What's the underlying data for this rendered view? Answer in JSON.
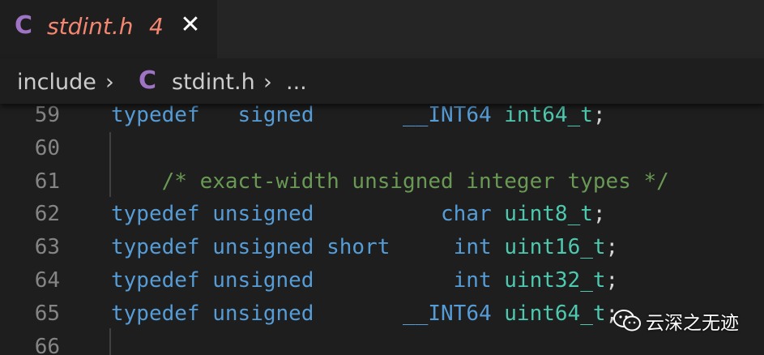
{
  "tab": {
    "icon": "C",
    "title": "stdint.h",
    "problem_count": "4",
    "close_glyph": "✕"
  },
  "breadcrumb": {
    "folder": "include",
    "separator": "›",
    "file_icon": "C",
    "file": "stdint.h",
    "more": "..."
  },
  "lines": [
    {
      "num": "59",
      "tokens": [
        [
          "kw",
          "typedef"
        ],
        [
          "pn",
          "   "
        ],
        [
          "kw",
          "signed"
        ],
        [
          "pn",
          "       "
        ],
        [
          "mc",
          "__INT64"
        ],
        [
          "pn",
          " "
        ],
        [
          "ty",
          "int64_t"
        ],
        [
          "pn",
          ";"
        ]
      ]
    },
    {
      "num": "60",
      "tokens": []
    },
    {
      "num": "61",
      "tokens": [
        [
          "pn",
          "    "
        ],
        [
          "cm",
          "/* exact-width unsigned integer types */"
        ]
      ]
    },
    {
      "num": "62",
      "tokens": [
        [
          "kw",
          "typedef"
        ],
        [
          "pn",
          " "
        ],
        [
          "kw",
          "unsigned"
        ],
        [
          "pn",
          "          "
        ],
        [
          "kw",
          "char"
        ],
        [
          "pn",
          " "
        ],
        [
          "ty",
          "uint8_t"
        ],
        [
          "pn",
          ";"
        ]
      ]
    },
    {
      "num": "63",
      "tokens": [
        [
          "kw",
          "typedef"
        ],
        [
          "pn",
          " "
        ],
        [
          "kw",
          "unsigned"
        ],
        [
          "pn",
          " "
        ],
        [
          "kw",
          "short"
        ],
        [
          "pn",
          "     "
        ],
        [
          "kw",
          "int"
        ],
        [
          "pn",
          " "
        ],
        [
          "ty",
          "uint16_t"
        ],
        [
          "pn",
          ";"
        ]
      ]
    },
    {
      "num": "64",
      "tokens": [
        [
          "kw",
          "typedef"
        ],
        [
          "pn",
          " "
        ],
        [
          "kw",
          "unsigned"
        ],
        [
          "pn",
          "           "
        ],
        [
          "kw",
          "int"
        ],
        [
          "pn",
          " "
        ],
        [
          "ty",
          "uint32_t"
        ],
        [
          "pn",
          ";"
        ]
      ]
    },
    {
      "num": "65",
      "tokens": [
        [
          "kw",
          "typedef"
        ],
        [
          "pn",
          " "
        ],
        [
          "kw",
          "unsigned"
        ],
        [
          "pn",
          "       "
        ],
        [
          "mc",
          "__INT64"
        ],
        [
          "pn",
          " "
        ],
        [
          "ty",
          "uint64_t"
        ],
        [
          "pn",
          ";"
        ]
      ]
    },
    {
      "num": "66",
      "tokens": []
    }
  ],
  "watermark": {
    "icon": "wechat-icon",
    "text": "云深之无迹"
  },
  "colors": {
    "keyword": "#569cd6",
    "type": "#4ec9b0",
    "comment": "#6a9955",
    "line_number": "#858585",
    "tab_title": "#f48771",
    "c_icon": "#a074c4",
    "background": "#1e1e1e"
  }
}
